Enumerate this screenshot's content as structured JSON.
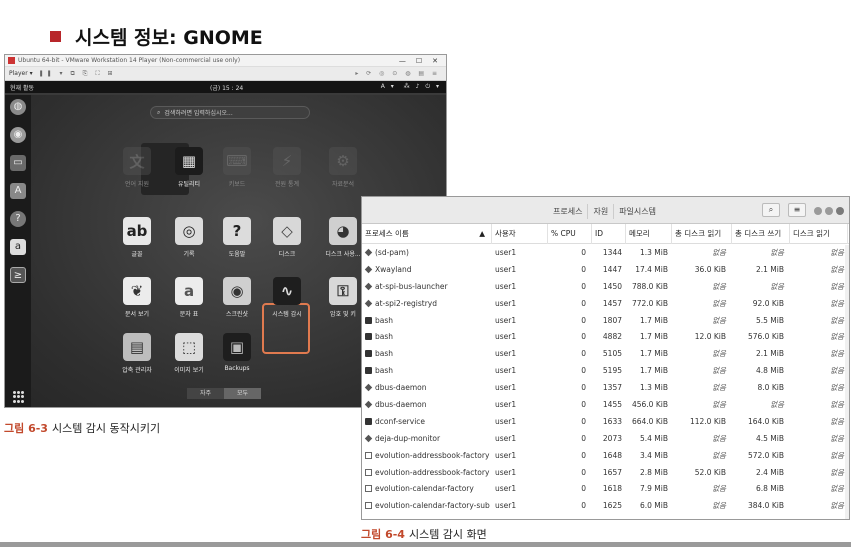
{
  "heading": "시스템 정보: GNOME",
  "vmware": {
    "title": "Ubuntu 64-bit - VMware Workstation 14 Player (Non-commercial use only)",
    "player_menu": "Player ▾",
    "activities": "현재 활동",
    "clock": "(금) 15 : 24",
    "input_indicator": "A ▾",
    "search_placeholder": "검색하려면 입력하십시오...",
    "apps": [
      {
        "label": "언어 지원",
        "glyph": "文",
        "dim": true
      },
      {
        "label": "유틸리티",
        "glyph": "▦",
        "dim": false
      },
      {
        "label": "키보드",
        "glyph": "⌨",
        "dim": true
      },
      {
        "label": "전원 통계",
        "glyph": "⚡",
        "dim": true
      },
      {
        "label": "자료분석",
        "glyph": "⚙",
        "dim": true
      },
      {
        "label": "글꼴",
        "glyph": "ab",
        "dim": false
      },
      {
        "label": "기록",
        "glyph": "◎",
        "dim": false
      },
      {
        "label": "도움말",
        "glyph": "?",
        "dim": false
      },
      {
        "label": "디스크",
        "glyph": "◇",
        "dim": false
      },
      {
        "label": "디스크 사용...",
        "glyph": "◕",
        "dim": false
      },
      {
        "label": "문서 보기",
        "glyph": "❦",
        "dim": false
      },
      {
        "label": "문자 표",
        "glyph": "a",
        "dim": false
      },
      {
        "label": "스크린샷",
        "glyph": "◉",
        "dim": false
      },
      {
        "label": "시스템 감시",
        "glyph": "∿",
        "dim": false
      },
      {
        "label": "암호 및 키",
        "glyph": "⚿",
        "dim": false
      },
      {
        "label": "압축 관리자",
        "glyph": "▤",
        "dim": false
      },
      {
        "label": "이미지 보기",
        "glyph": "⬚",
        "dim": false
      },
      {
        "label": "Backups",
        "glyph": "▣",
        "dim": false
      }
    ],
    "toggle": [
      "자주",
      "모두"
    ]
  },
  "caption1": {
    "number": "그림 6-3",
    "text": "시스템 감시 동작시키기"
  },
  "monitor": {
    "tabs": [
      "프로세스",
      "자원",
      "파일시스템"
    ],
    "columns": [
      "프로세스 이름",
      "사용자",
      "% CPU",
      "ID",
      "메모리",
      "총 디스크 읽기",
      "총 디스크 쓰기",
      "디스크 읽기"
    ],
    "rows": [
      {
        "icon": "diamond",
        "name": "(sd-pam)",
        "user": "user1",
        "cpu": "0",
        "id": "1344",
        "mem": "1.3 MiB",
        "read": "없음",
        "write": "없음",
        "dread": "없음"
      },
      {
        "icon": "diamond",
        "name": "Xwayland",
        "user": "user1",
        "cpu": "0",
        "id": "1447",
        "mem": "17.4 MiB",
        "read": "36.0 KiB",
        "write": "2.1 MiB",
        "dread": "없음"
      },
      {
        "icon": "diamond",
        "name": "at-spi-bus-launcher",
        "user": "user1",
        "cpu": "0",
        "id": "1450",
        "mem": "788.0 KiB",
        "read": "없음",
        "write": "없음",
        "dread": "없음"
      },
      {
        "icon": "diamond",
        "name": "at-spi2-registryd",
        "user": "user1",
        "cpu": "0",
        "id": "1457",
        "mem": "772.0 KiB",
        "read": "없음",
        "write": "92.0 KiB",
        "dread": "없음"
      },
      {
        "icon": "term",
        "name": "bash",
        "user": "user1",
        "cpu": "0",
        "id": "1807",
        "mem": "1.7 MiB",
        "read": "없음",
        "write": "5.5 MiB",
        "dread": "없음"
      },
      {
        "icon": "term",
        "name": "bash",
        "user": "user1",
        "cpu": "0",
        "id": "4882",
        "mem": "1.7 MiB",
        "read": "12.0 KiB",
        "write": "576.0 KiB",
        "dread": "없음"
      },
      {
        "icon": "term",
        "name": "bash",
        "user": "user1",
        "cpu": "0",
        "id": "5105",
        "mem": "1.7 MiB",
        "read": "없음",
        "write": "2.1 MiB",
        "dread": "없음"
      },
      {
        "icon": "term",
        "name": "bash",
        "user": "user1",
        "cpu": "0",
        "id": "5195",
        "mem": "1.7 MiB",
        "read": "없음",
        "write": "4.8 MiB",
        "dread": "없음"
      },
      {
        "icon": "diamond",
        "name": "dbus-daemon",
        "user": "user1",
        "cpu": "0",
        "id": "1357",
        "mem": "1.3 MiB",
        "read": "없음",
        "write": "8.0 KiB",
        "dread": "없음"
      },
      {
        "icon": "diamond",
        "name": "dbus-daemon",
        "user": "user1",
        "cpu": "0",
        "id": "1455",
        "mem": "456.0 KiB",
        "read": "없음",
        "write": "없음",
        "dread": "없음"
      },
      {
        "icon": "term",
        "name": "dconf-service",
        "user": "user1",
        "cpu": "0",
        "id": "1633",
        "mem": "664.0 KiB",
        "read": "112.0 KiB",
        "write": "164.0 KiB",
        "dread": "없음"
      },
      {
        "icon": "diamond",
        "name": "deja-dup-monitor",
        "user": "user1",
        "cpu": "0",
        "id": "2073",
        "mem": "5.4 MiB",
        "read": "없음",
        "write": "4.5 MiB",
        "dread": "없음"
      },
      {
        "icon": "file",
        "name": "evolution-addressbook-factory",
        "user": "user1",
        "cpu": "0",
        "id": "1648",
        "mem": "3.4 MiB",
        "read": "없음",
        "write": "572.0 KiB",
        "dread": "없음"
      },
      {
        "icon": "file",
        "name": "evolution-addressbook-factory",
        "user": "user1",
        "cpu": "0",
        "id": "1657",
        "mem": "2.8 MiB",
        "read": "52.0 KiB",
        "write": "2.4 MiB",
        "dread": "없음"
      },
      {
        "icon": "file",
        "name": "evolution-calendar-factory",
        "user": "user1",
        "cpu": "0",
        "id": "1618",
        "mem": "7.9 MiB",
        "read": "없음",
        "write": "6.8 MiB",
        "dread": "없음"
      },
      {
        "icon": "file",
        "name": "evolution-calendar-factory-sub",
        "user": "user1",
        "cpu": "0",
        "id": "1625",
        "mem": "6.0 MiB",
        "read": "없음",
        "write": "384.0 KiB",
        "dread": "없음"
      }
    ]
  },
  "caption2": {
    "number": "그림 6-4",
    "text": "시스템 감시 화면"
  },
  "colors": {
    "accent": "#b8262a",
    "caption": "#c2492c",
    "highlight": "#e07a4f"
  }
}
